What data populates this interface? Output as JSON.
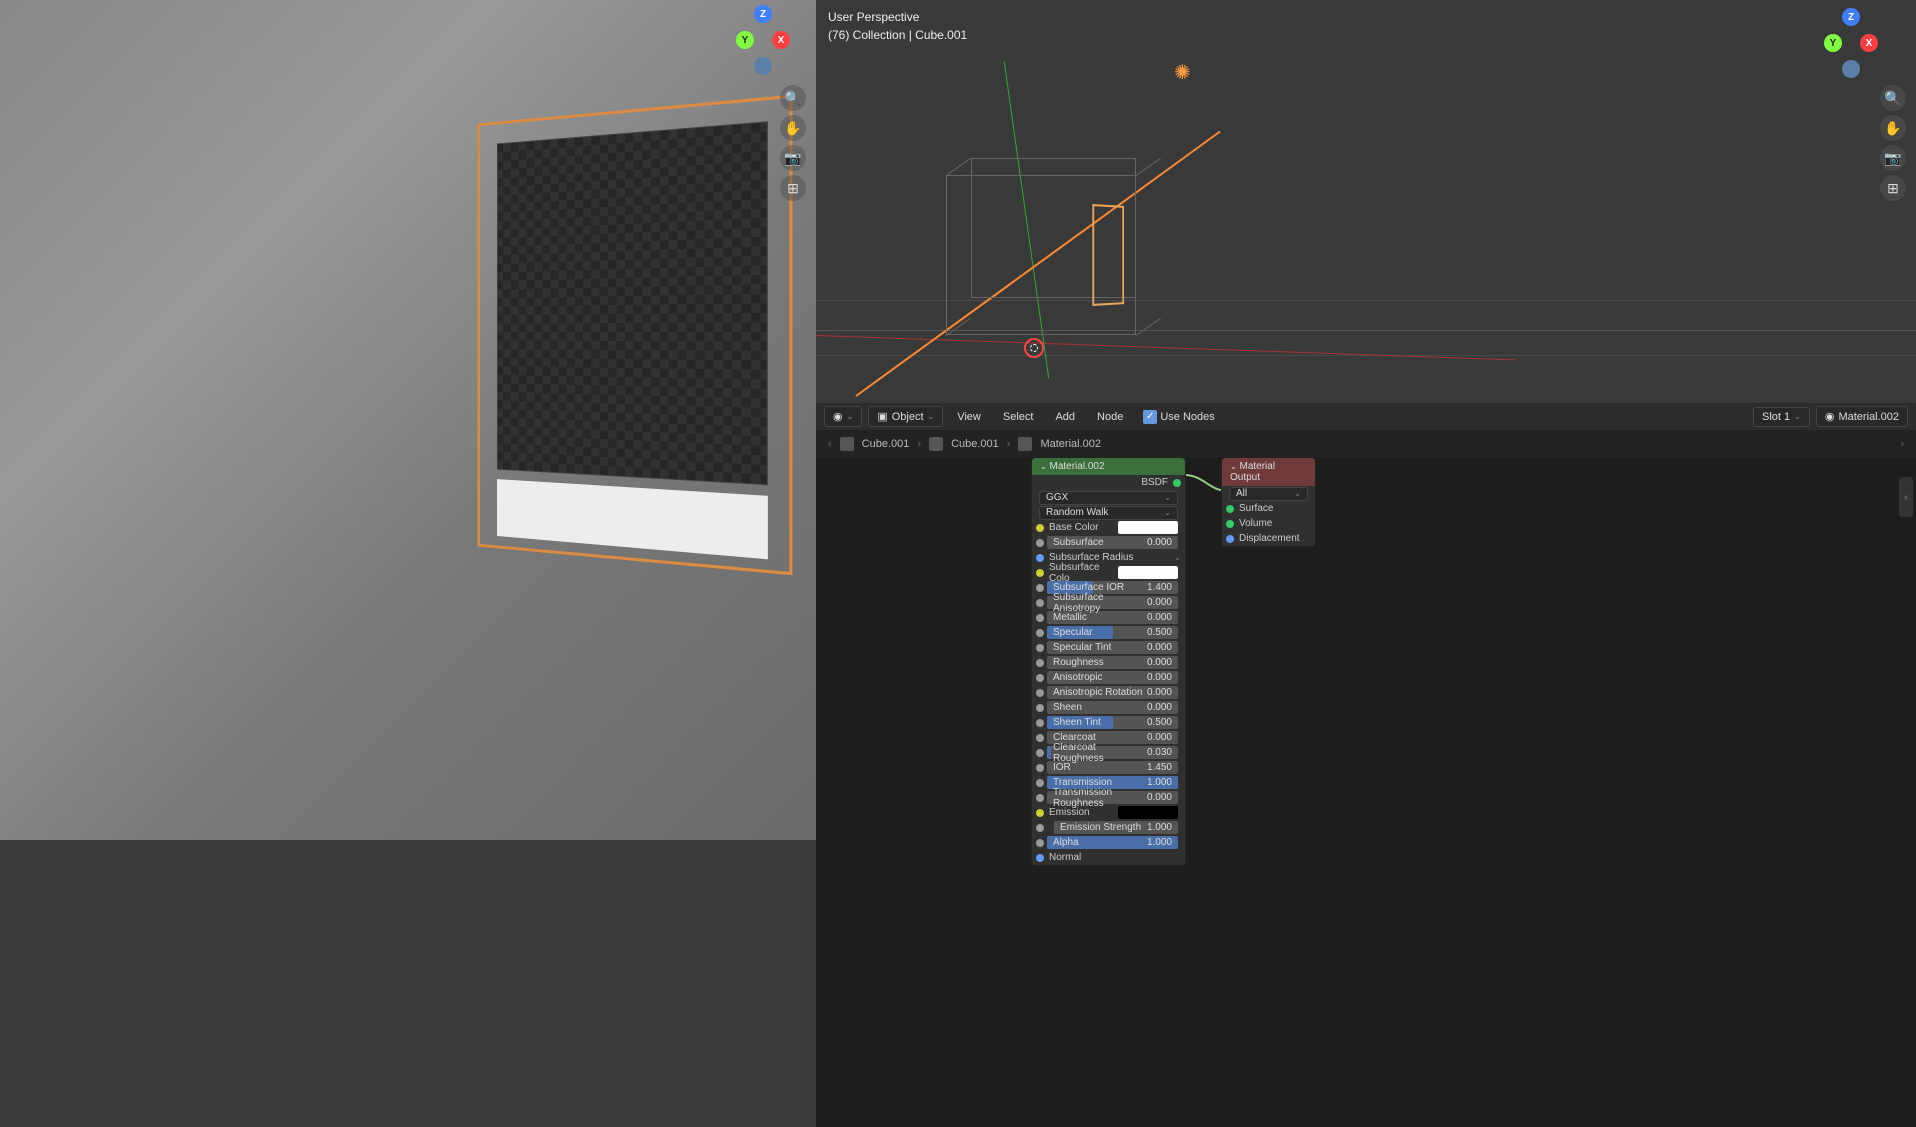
{
  "left_viewport": {},
  "right_viewport": {
    "header_line1": "User Perspective",
    "header_line2": "(76) Collection | Cube.001"
  },
  "gizmo": {
    "z": "Z",
    "y": "Y",
    "x": "X"
  },
  "node_editor": {
    "header": {
      "mode": "Object",
      "menus": [
        "View",
        "Select",
        "Add",
        "Node"
      ],
      "use_nodes_label": "Use Nodes",
      "slot": "Slot 1",
      "material": "Material.002"
    },
    "breadcrumb": {
      "obj": "Cube.001",
      "mesh": "Cube.001",
      "mat": "Material.002"
    },
    "bsdf_node": {
      "title": "Material.002",
      "out": "BSDF",
      "distribution": "GGX",
      "sss_method": "Random Walk",
      "props": [
        {
          "sock": "y",
          "label": "Base Color",
          "type": "color",
          "color": "#ffffff"
        },
        {
          "sock": "g",
          "label": "Subsurface",
          "type": "slider",
          "value": "0.000",
          "fill": 0
        },
        {
          "sock": "b",
          "label": "Subsurface Radius",
          "type": "dropdown"
        },
        {
          "sock": "y",
          "label": "Subsurface Colo",
          "type": "color",
          "color": "#ffffff"
        },
        {
          "sock": "g",
          "label": "Subsurface IOR",
          "type": "slider",
          "value": "1.400",
          "fill": 35
        },
        {
          "sock": "g",
          "label": "Subsurface Anisotropy",
          "type": "slider",
          "value": "0.000",
          "fill": 0
        },
        {
          "sock": "g",
          "label": "Metallic",
          "type": "slider",
          "value": "0.000",
          "fill": 0
        },
        {
          "sock": "g",
          "label": "Specular",
          "type": "slider",
          "value": "0.500",
          "fill": 50
        },
        {
          "sock": "g",
          "label": "Specular Tint",
          "type": "slider",
          "value": "0.000",
          "fill": 0
        },
        {
          "sock": "g",
          "label": "Roughness",
          "type": "slider",
          "value": "0.000",
          "fill": 0
        },
        {
          "sock": "g",
          "label": "Anisotropic",
          "type": "slider",
          "value": "0.000",
          "fill": 0
        },
        {
          "sock": "g",
          "label": "Anisotropic Rotation",
          "type": "slider",
          "value": "0.000",
          "fill": 0
        },
        {
          "sock": "g",
          "label": "Sheen",
          "type": "slider",
          "value": "0.000",
          "fill": 0
        },
        {
          "sock": "g",
          "label": "Sheen Tint",
          "type": "slider",
          "value": "0.500",
          "fill": 50
        },
        {
          "sock": "g",
          "label": "Clearcoat",
          "type": "slider",
          "value": "0.000",
          "fill": 0
        },
        {
          "sock": "g",
          "label": "Clearcoat Roughness",
          "type": "slider",
          "value": "0.030",
          "fill": 3
        },
        {
          "sock": "g",
          "label": "IOR",
          "type": "slider",
          "value": "1.450",
          "fill": 0
        },
        {
          "sock": "g",
          "label": "Transmission",
          "type": "slider",
          "value": "1.000",
          "fill": 100
        },
        {
          "sock": "g",
          "label": "Transmission Roughness",
          "type": "slider",
          "value": "0.000",
          "fill": 0
        },
        {
          "sock": "y",
          "label": "Emission",
          "type": "color",
          "color": "#000000"
        },
        {
          "sock": "g",
          "label": "Emission Strength",
          "type": "slider",
          "value": "1.000",
          "fill": 0,
          "indent": true
        },
        {
          "sock": "g",
          "label": "Alpha",
          "type": "slider",
          "value": "1.000",
          "fill": 100
        },
        {
          "sock": "b",
          "label": "Normal",
          "type": "label"
        }
      ]
    },
    "output_node": {
      "title": "Material Output",
      "target": "All",
      "ins": [
        "Surface",
        "Volume",
        "Displacement"
      ]
    }
  }
}
